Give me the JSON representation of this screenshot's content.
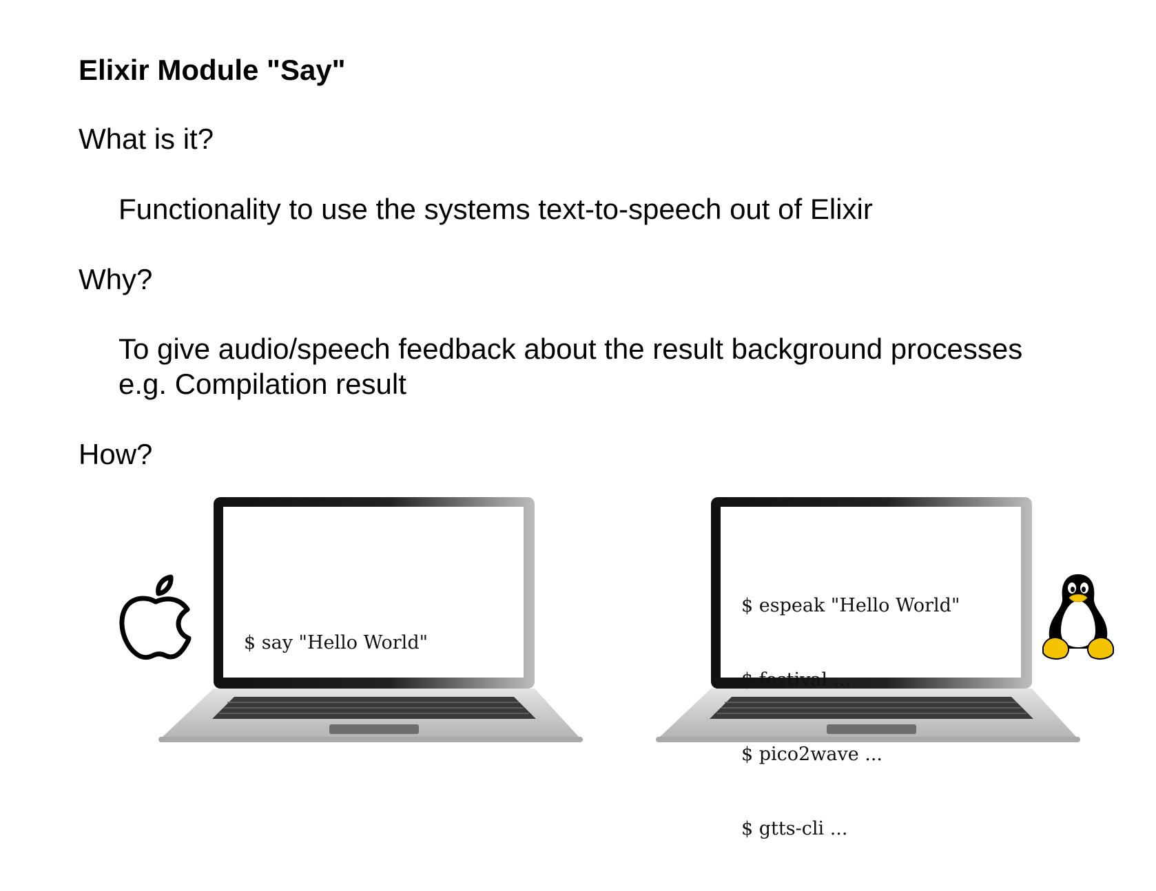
{
  "slide": {
    "title": "Elixir Module \"Say\""
  },
  "sections": {
    "what_heading": "What is it?",
    "what_body": "Functionality to use the systems text-to-speech out of Elixir",
    "why_heading": "Why?",
    "why_body_line1": "To give audio/speech feedback about the result background processes",
    "why_body_line2": "e.g. Compilation result",
    "how_heading": "How?"
  },
  "mac_laptop": {
    "icon": "apple-logo-icon",
    "commands": [
      "$ say \"Hello World\""
    ]
  },
  "linux_laptop": {
    "icon": "tux-penguin-icon",
    "commands": [
      "$ espeak \"Hello World\"",
      "$ festival ...",
      "$ pico2wave ...",
      "$ gtts-cli ..."
    ]
  },
  "colors": {
    "linux_beak_feet": "#f5c400",
    "laptop_bezel": "#1a1a1a",
    "laptop_base": "#c8c8c8"
  }
}
